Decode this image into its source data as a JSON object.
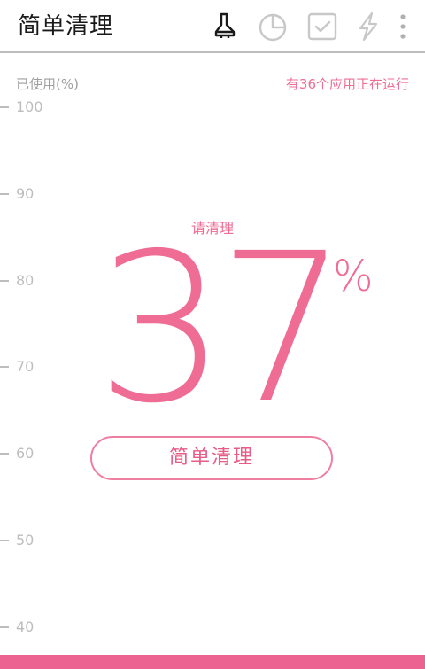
{
  "app_bar": {
    "title": "简单清理",
    "icons": [
      "brush-icon",
      "pie-chart-icon",
      "checkbox-icon",
      "lightning-icon",
      "overflow-menu-icon"
    ]
  },
  "usage": {
    "label": "已使用(%)",
    "running_apps": "有36个应用正在运行",
    "scale": [
      "100",
      "90",
      "80",
      "70",
      "60",
      "50",
      "40"
    ],
    "status_hint": "请清理",
    "percent_value": "37",
    "percent_sign": "%"
  },
  "actions": {
    "clean_button": "简单清理"
  },
  "colors": {
    "accent": "#ef6c94",
    "bottom_bar": "#ec6291",
    "muted": "#bdbdbd"
  }
}
